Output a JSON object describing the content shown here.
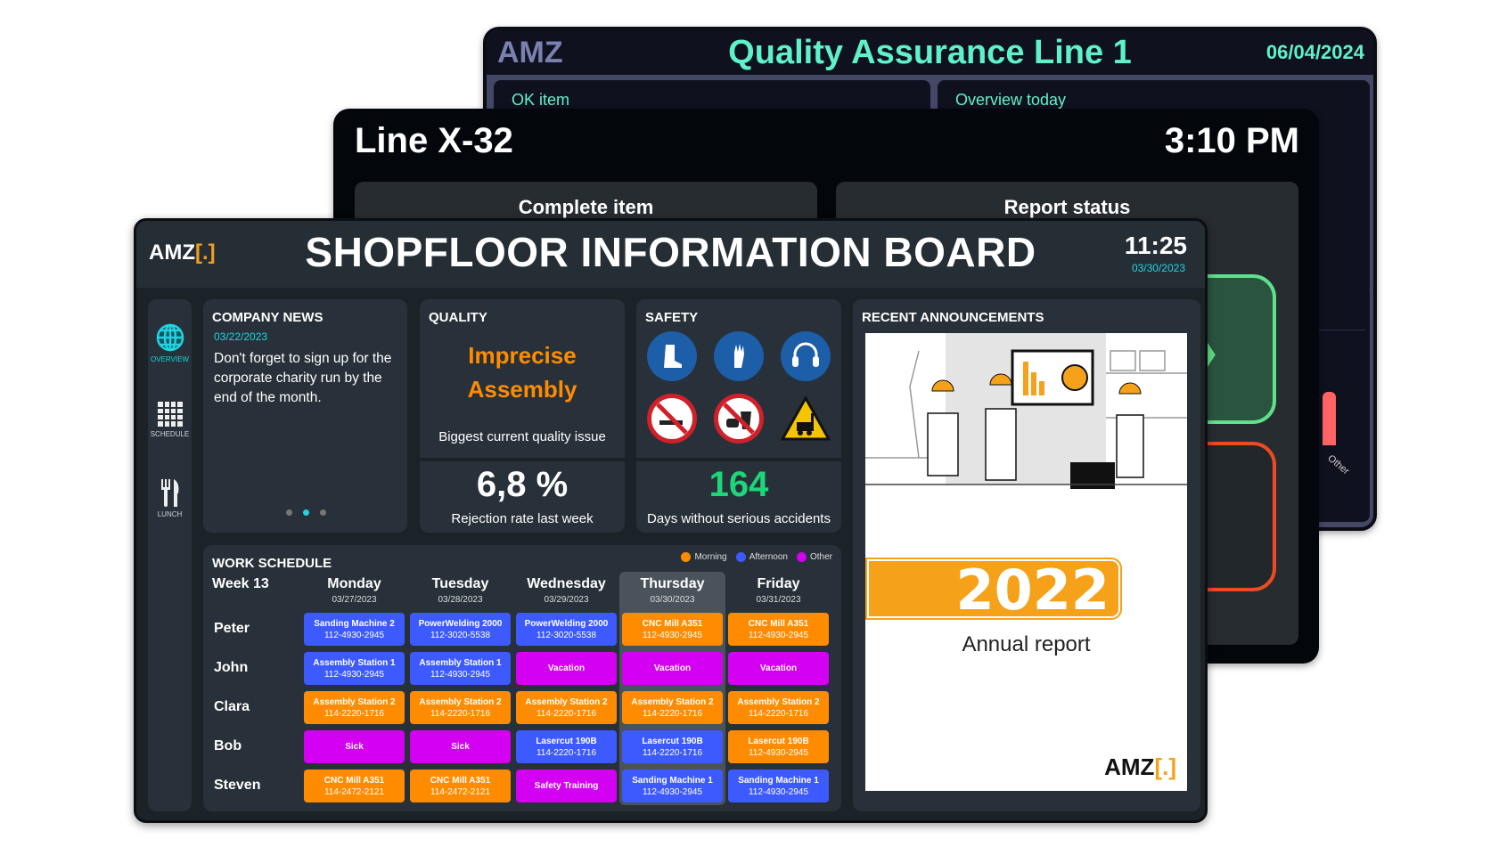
{
  "qa_screen": {
    "logo": "AMZ",
    "title": "Quality Assurance Line 1",
    "date": "06/04/2024",
    "cards": [
      "OK item",
      "Overview today"
    ],
    "chart_label": "Other"
  },
  "line_screen": {
    "title": "Line X-32",
    "time": "3:10 PM",
    "cards": [
      "Complete item",
      "Report status"
    ]
  },
  "board": {
    "logo": "AMZ",
    "title": "SHOPFLOOR INFORMATION BOARD",
    "time": "11:25",
    "date": "03/30/2023",
    "sidebar": [
      {
        "label": "OVERVIEW",
        "icon": "globe-icon",
        "active": true
      },
      {
        "label": "SCHEDULE",
        "icon": "calendar-icon"
      },
      {
        "label": "LUNCH",
        "icon": "fork-knife-icon"
      }
    ],
    "news": {
      "title": "COMPANY NEWS",
      "date": "03/22/2023",
      "text": "Don't forget to sign up for the corporate charity run by the end of the month.",
      "pages": 3,
      "current_page": 2
    },
    "quality": {
      "title": "QUALITY",
      "issue": "Imprecise Assembly",
      "issue_label": "Biggest current quality issue",
      "rate": "6,8 %",
      "rate_label": "Rejection rate last week"
    },
    "safety": {
      "title": "SAFETY",
      "signs": [
        "safety-boots-icon",
        "safety-gloves-icon",
        "ear-protection-icon",
        "no-smoking-icon",
        "no-food-drink-icon",
        "forklift-warning-icon"
      ],
      "days": "164",
      "days_label": "Days without serious accidents"
    },
    "schedule": {
      "title": "WORK SCHEDULE",
      "week": "Week 13",
      "legend": [
        {
          "label": "Morning",
          "color": "#ff8c00"
        },
        {
          "label": "Afternoon",
          "color": "#3d5afe"
        },
        {
          "label": "Other",
          "color": "#d400f2"
        }
      ],
      "days": [
        {
          "name": "Monday",
          "date": "03/27/2023"
        },
        {
          "name": "Tuesday",
          "date": "03/28/2023"
        },
        {
          "name": "Wednesday",
          "date": "03/29/2023"
        },
        {
          "name": "Thursday",
          "date": "03/30/2023",
          "today": true
        },
        {
          "name": "Friday",
          "date": "03/31/2023"
        }
      ],
      "rows": [
        {
          "name": "Peter",
          "cells": [
            [
              "Sanding Machine 2",
              "112-4930-2945",
              "a"
            ],
            [
              "PowerWelding 2000",
              "112-3020-5538",
              "a"
            ],
            [
              "PowerWelding 2000",
              "112-3020-5538",
              "a"
            ],
            [
              "CNC Mill A351",
              "112-4930-2945",
              "m"
            ],
            [
              "CNC Mill A351",
              "112-4930-2945",
              "m"
            ]
          ]
        },
        {
          "name": "John",
          "cells": [
            [
              "Assembly Station 1",
              "112-4930-2945",
              "a"
            ],
            [
              "Assembly Station 1",
              "112-4930-2945",
              "a"
            ],
            [
              "Vacation",
              "",
              "o"
            ],
            [
              "Vacation",
              "",
              "o"
            ],
            [
              "Vacation",
              "",
              "o"
            ]
          ]
        },
        {
          "name": "Clara",
          "cells": [
            [
              "Assembly Station 2",
              "114-2220-1716",
              "m"
            ],
            [
              "Assembly Station 2",
              "114-2220-1716",
              "m"
            ],
            [
              "Assembly Station 2",
              "114-2220-1716",
              "m"
            ],
            [
              "Assembly Station 2",
              "114-2220-1716",
              "m"
            ],
            [
              "Assembly Station 2",
              "114-2220-1716",
              "m"
            ]
          ]
        },
        {
          "name": "Bob",
          "cells": [
            [
              "Sick",
              "",
              "o"
            ],
            [
              "Sick",
              "",
              "o"
            ],
            [
              "Lasercut 190B",
              "114-2220-1716",
              "a"
            ],
            [
              "Lasercut 190B",
              "114-2220-1716",
              "a"
            ],
            [
              "Lasercut 190B",
              "112-4930-2945",
              "m"
            ]
          ]
        },
        {
          "name": "Steven",
          "cells": [
            [
              "CNC Mill A351",
              "114-2472-2121",
              "m"
            ],
            [
              "CNC Mill A351",
              "114-2472-2121",
              "m"
            ],
            [
              "Safety Training",
              "",
              "o"
            ],
            [
              "Sanding Machine 1",
              "112-4930-2945",
              "a"
            ],
            [
              "Sanding Machine 1",
              "112-4930-2945",
              "a"
            ]
          ]
        }
      ]
    },
    "announcements": {
      "title": "RECENT ANNOUNCEMENTS",
      "year": "2022",
      "caption": "Annual report",
      "logo": "AMZ"
    }
  },
  "colors": {
    "teal": "#22d3e0",
    "green": "#1ed67a",
    "orange": "#ff8c00",
    "blue": "#3d5afe",
    "purple": "#d400f2",
    "qa_accent": "#5ff2c8"
  }
}
